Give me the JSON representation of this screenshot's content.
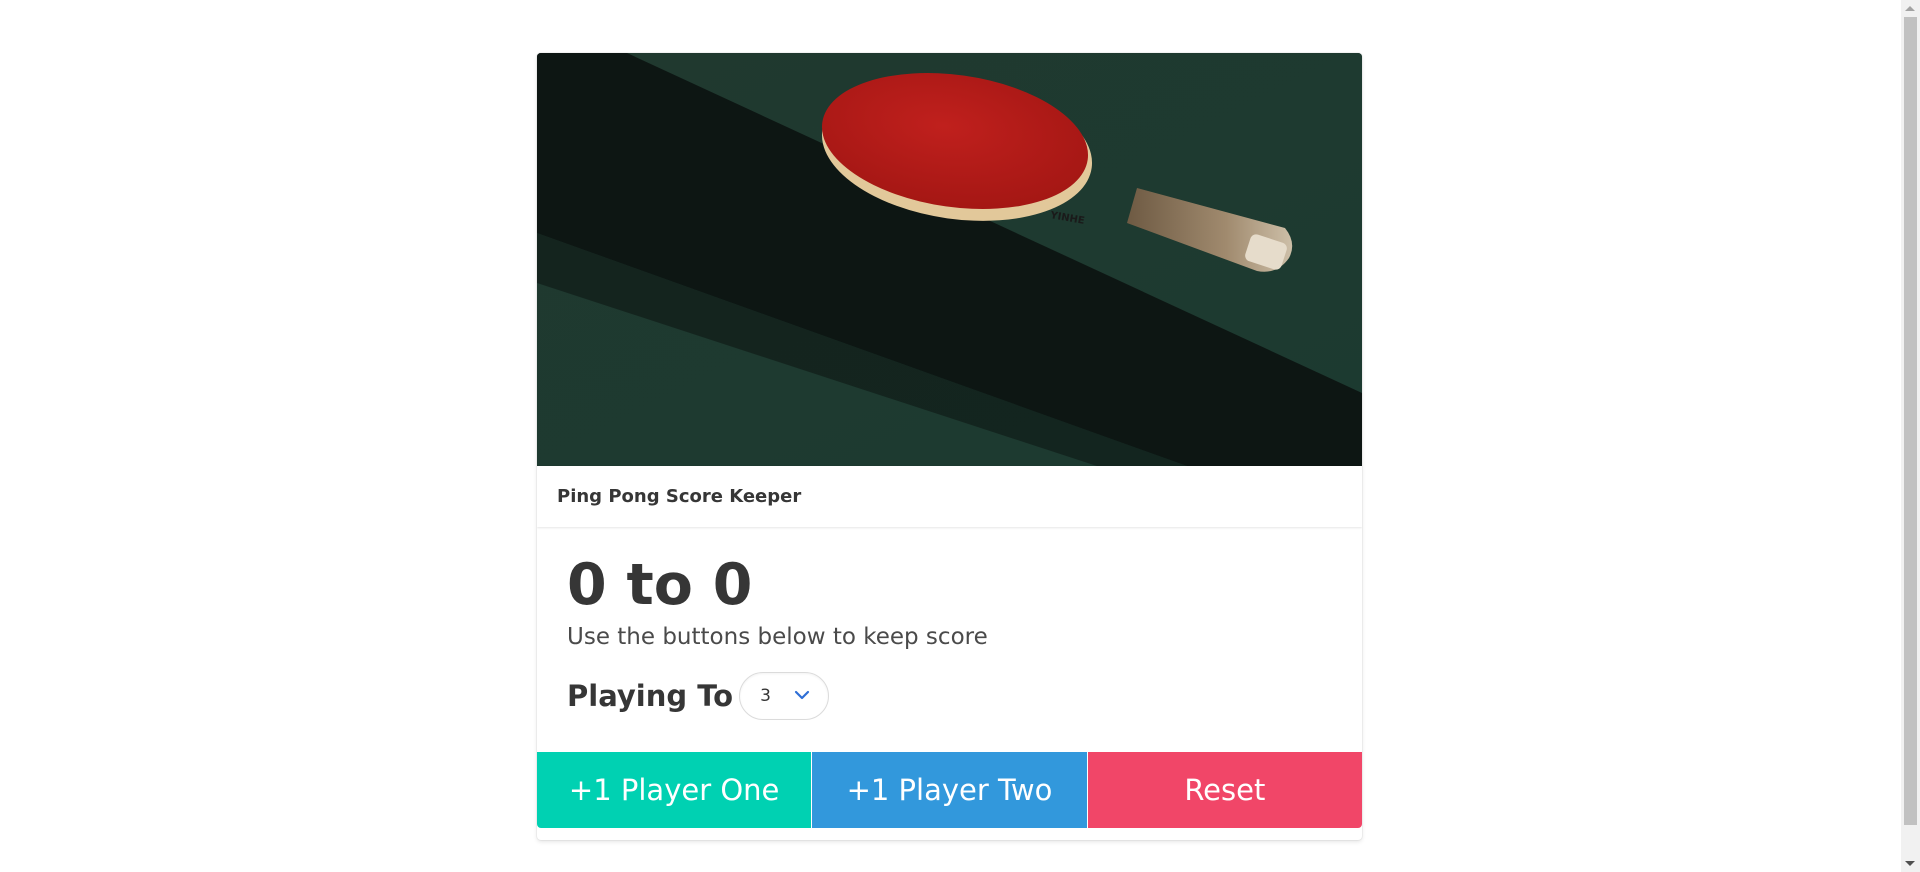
{
  "card": {
    "image": {
      "alt": "ping-pong-paddle-photo",
      "brand_text": "YINHE"
    },
    "header_title": "Ping Pong Score Keeper",
    "score": {
      "player_one": 0,
      "player_two": 0,
      "text": "0 to 0"
    },
    "subtitle": "Use the buttons below to keep score",
    "playing_to": {
      "label": "Playing To",
      "selected": "3"
    },
    "buttons": {
      "player_one": "+1 Player One",
      "player_two": "+1 Player Two",
      "reset": "Reset"
    }
  },
  "colors": {
    "player_one": "#00d1b2",
    "player_two": "#3298dc",
    "reset": "#f14668",
    "text": "#363636"
  }
}
